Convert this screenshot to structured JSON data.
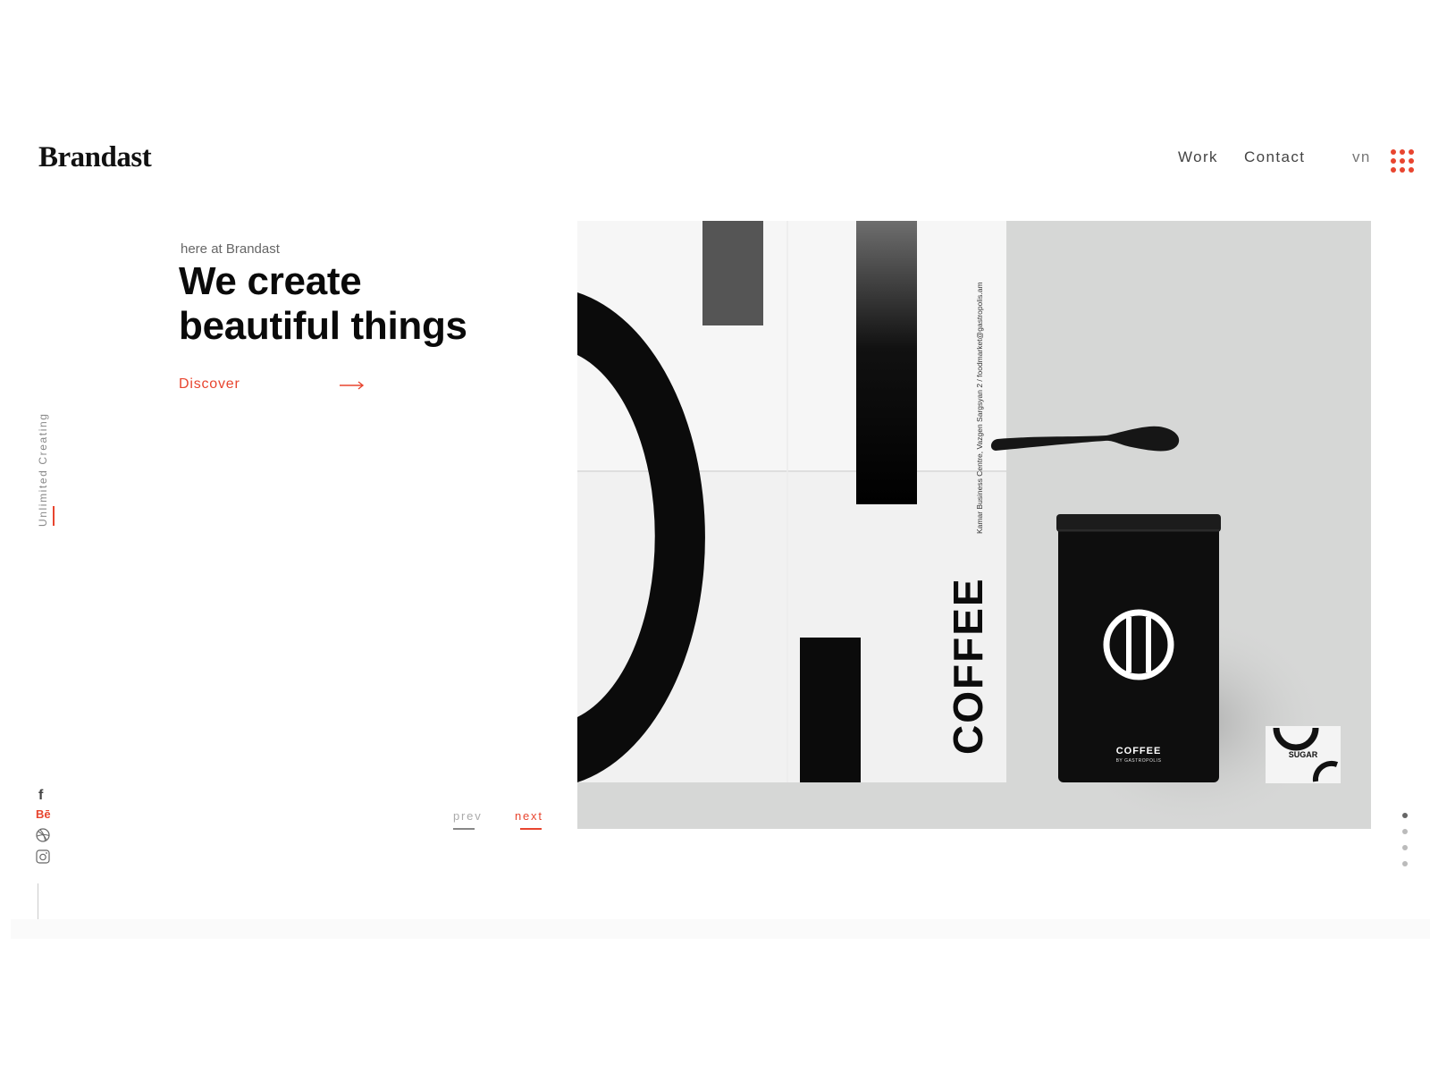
{
  "header": {
    "logo": "Brandast",
    "nav": [
      {
        "label": "Work"
      },
      {
        "label": "Contact"
      }
    ],
    "language": "vn",
    "menu_icon": "grid-dots-icon"
  },
  "hero": {
    "kicker": "here at Brandast",
    "headline_line1": "We create",
    "headline_line2": "beautiful things",
    "cta_label": "Discover",
    "cta_icon": "arrow-right-icon"
  },
  "side": {
    "vertical_label": "Unlimited Creating"
  },
  "social": [
    {
      "name": "facebook-icon",
      "glyph": "f"
    },
    {
      "name": "behance-icon",
      "glyph": "Bē"
    },
    {
      "name": "dribbble-icon"
    },
    {
      "name": "instagram-icon"
    }
  ],
  "pager": {
    "prev_label": "prev",
    "next_label": "next"
  },
  "image": {
    "poster_text": "COFFEE",
    "poster_address": "Kamar Business Centre, Vazgen Sargsyan 2 / foodmarket@gastropolis.am",
    "tin_title": "COFFEE",
    "tin_subtitle": "BY GASTROPOLIS",
    "sugar_label": "SUGAR"
  },
  "slider": {
    "total": 4,
    "active": 1
  },
  "colors": {
    "accent": "#e8452f",
    "text": "#111111",
    "image_bg": "#d6d7d6"
  }
}
